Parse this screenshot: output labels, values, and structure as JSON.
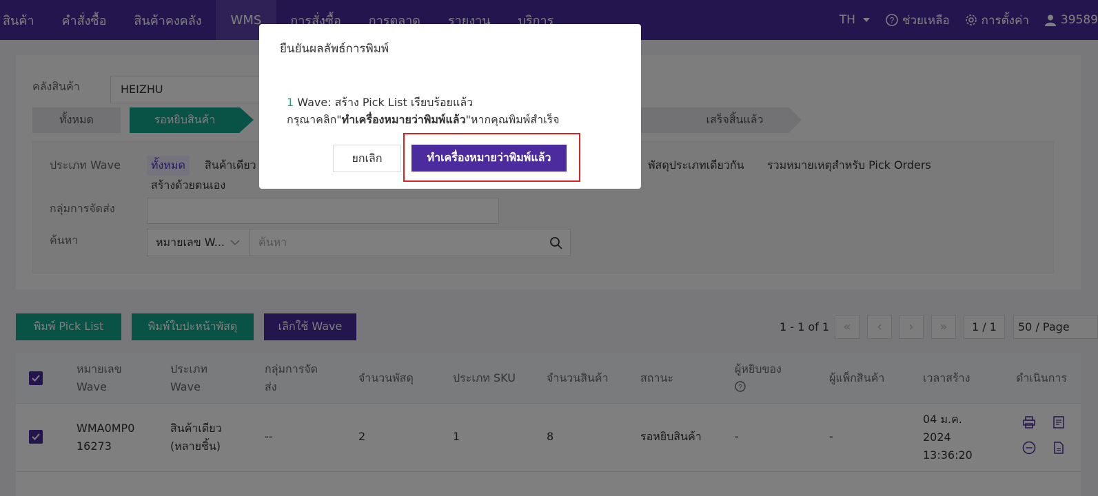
{
  "nav": {
    "items": [
      "สินค้า",
      "คำสั่งซื้อ",
      "สินค้าคงคลัง",
      "WMS",
      "การสั่งซื้อ",
      "การตลาด",
      "รายงาน",
      "บริการ"
    ],
    "lang": "TH",
    "help": "ช่วยเหลือ",
    "settings": "การตั้งค่า",
    "user": "39589"
  },
  "filters": {
    "warehouse_label": "คลังสินค้า",
    "warehouse_value": "HEIZHU",
    "status_tabs": [
      "ทั้งหมด",
      "รอหยิบสินค้า",
      "เสร็จสิ้นแล้ว"
    ],
    "wave_type_label": "ประเภท Wave",
    "wave_types": [
      "ทั้งหมด",
      "สินค้าเดียว",
      "พัสดุประเภทเดียวกัน",
      "รวมหมายเหตุสำหรับ Pick Orders",
      "สร้างด้วยตนเอง"
    ],
    "shipping_group_label": "กลุ่มการจัดส่ง",
    "search_label": "ค้นหา",
    "search_field_select": "หมายเลข W...",
    "search_placeholder": "ค้นหา"
  },
  "actions": {
    "print_picklist": "พิมพ์ Pick List",
    "print_labels": "พิมพ์ใบปะหน้าพัสดุ",
    "cancel_wave": "เลิกใช้ Wave"
  },
  "pager": {
    "range": "1 - 1 of 1",
    "page": "1 / 1",
    "page_size": "50 / Page"
  },
  "table": {
    "headers": {
      "wave_no_1": "หมายเลข",
      "wave_no_2": "Wave",
      "wave_type_1": "ประเภท",
      "wave_type_2": "Wave",
      "group_1": "กลุ่มการจัด",
      "group_2": "ส่ง",
      "parcels": "จำนวนพัสดุ",
      "sku_type": "ประเภท SKU",
      "qty": "จำนวนสินค้า",
      "status": "สถานะ",
      "picker": "ผู้หยิบของ",
      "packer": "ผู้แพ็กสินค้า",
      "created": "เวลาสร้าง",
      "ops": "ดำเนินการ"
    },
    "rows": [
      {
        "wave_no_1": "WMA0MP0",
        "wave_no_2": "16273",
        "wave_type_1": "สินค้าเดียว",
        "wave_type_2": "(หลายชิ้น)",
        "group": "--",
        "parcels": "2",
        "sku_type": "1",
        "qty": "8",
        "status": "รอหยิบสินค้า",
        "picker": "-",
        "packer": "-",
        "created_1": "04 ม.ค.",
        "created_2": "2024",
        "created_3": "13:36:20"
      }
    ]
  },
  "modal": {
    "title": "ยืนยันผลลัพธ์การพิมพ์",
    "count": "1",
    "line1_rest": " Wave:  สร้าง Pick List เรียบร้อยแล้ว",
    "line2_pre": "กรุณาคลิก\"",
    "line2_bold": "ทำเครื่องหมายว่าพิมพ์แล้ว",
    "line2_post": "\"หากคุณพิมพ์สำเร็จ",
    "cancel": "ยกเลิก",
    "confirm": "ทำเครื่องหมายว่าพิมพ์แล้ว"
  },
  "colors": {
    "brand_purple": "#4b2b9e",
    "accent_green": "#12a58c",
    "highlight_red": "#e02020"
  }
}
